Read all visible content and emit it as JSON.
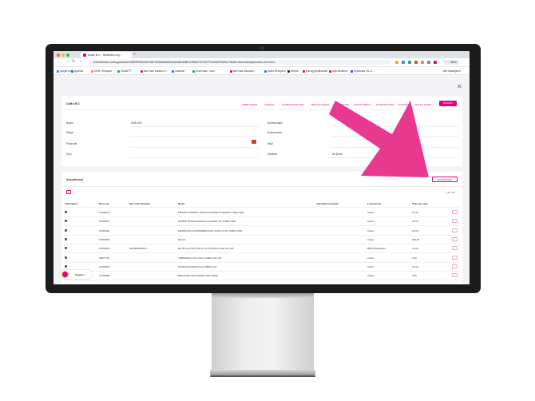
{
  "browser": {
    "tab_title": "DoBo B.V. - Bestellen org... ",
    "new_tab": "+",
    "url": "hub.bartrack.com/organizations/ff5939952d49a7a0b7634f2a85e0b4aaea59c8d8be23f9a97b7016770c26b2076d0c27detail=assortment&previous-url=/users",
    "profile": "Werk",
    "bookmarks": [
      {
        "label": "google mail",
        "color": "#4285f4"
      },
      {
        "label": "Agenda",
        "color": "#1a73e8"
      },
      {
        "label": "CRM | Hubspot",
        "color": "#ff7a59"
      },
      {
        "label": "ChatGPT",
        "color": "#10a37f"
      },
      {
        "label": "BarTrack Kanban b...",
        "color": "#e5007d"
      },
      {
        "label": "Leadinfo",
        "color": "#2f6fd6"
      },
      {
        "label": "Excel taak - snel...",
        "color": "#21a366"
      },
      {
        "label": "BarTrack Inkoopm...",
        "color": "#e5007d"
      },
      {
        "label": "Sales Recepten",
        "color": "#1a73e8"
      },
      {
        "label": "GitHub",
        "color": "#24292e"
      },
      {
        "label": "pricing groothandel",
        "color": "#e5007d"
      },
      {
        "label": "prijs bestellen",
        "color": "#e5007d"
      },
      {
        "label": "Synthesia | AI vi...",
        "color": "#4b3cfa"
      }
    ],
    "all_bookmarks": "Alle bladwijzers"
  },
  "company": {
    "name": "DoBo B.V.",
    "tabs": [
      "GEBRUIKERS",
      "AGENDA",
      "LEVERINGSOPTIES",
      "BESTELLINGEN",
      "ACTIVITEITEN",
      "ASSORTIMENT",
      "LEVERANCIERS",
      "LOCATIES",
      "INSTELLINGEN"
    ],
    "edit_label": "BEWERK",
    "fields_left": [
      {
        "label": "Naam",
        "value": "DoBo B.V."
      },
      {
        "label": "Straat",
        "value": ""
      },
      {
        "label": "Postcode",
        "value": ""
      },
      {
        "label": "GLN",
        "value": ""
      }
    ],
    "fields_right": [
      {
        "label": "Domeinnaam",
        "value": ""
      },
      {
        "label": "Huisnummer",
        "value": ""
      },
      {
        "label": "Stad",
        "value": ""
      },
      {
        "label": "Klantkee",
        "value": "De Bever"
      }
    ]
  },
  "assortment": {
    "title": "Assortiment",
    "import_label": "IMPORTEREN",
    "filter_icon_glyph": "≡",
    "pager": "1-10 / 55",
    "columns": [
      "Afbeelding",
      "Barcode",
      "Barcode fabrikant",
      "Naam",
      "Bestelhoeveelheid",
      "Leverancier",
      "Prijs per stuk"
    ],
    "rows": [
      {
        "barcode": "16038143",
        "barcode_fab": "",
        "name": "MINIMS POVIDON JODIUM OOGDR 5I MINIMS TUBE 0,5ML",
        "qty": "",
        "supplier": "Cebon",
        "price": "12,40"
      },
      {
        "barcode": "15308214",
        "barcode_fab": "",
        "name": "MINIMS TETRACAINE HCL OOGDR 1% TUBE 0,5ML",
        "qty": "",
        "supplier": "Cebon",
        "price": "13,00"
      },
      {
        "barcode": "15303492",
        "barcode_fab": "",
        "name": "MINIMS PILOCARPINENITRAAT OOGD R 2% TUBE 0,5ML",
        "qty": "",
        "supplier": "Cebon",
        "price": "13,00"
      },
      {
        "barcode": "15503656",
        "barcode_fab": "",
        "name": "Mecrat",
        "qty": "",
        "supplier": "Cebon",
        "price": "204,00"
      },
      {
        "barcode": "12531863",
        "barcode_fab": "4013285138514",
        "name": "BH 56 inch DIN 3126 E 6,3 T15x25mm Rak van 100",
        "qty": "",
        "supplier": "BRKS Nederland",
        "price": "13,00"
      },
      {
        "barcode": "15827767",
        "barcode_fab": "",
        "name": "TOBRADEX OOG ZALF TUBE 3,5G 107",
        "qty": "",
        "supplier": "Cebon",
        "price": "4,20"
      },
      {
        "barcode": "14795433",
        "barcode_fab": "",
        "name": "DIAMOX WUPER FLAC 500MG 107",
        "qty": "",
        "supplier": "Cebon",
        "price": "15,00"
      },
      {
        "barcode": "12105689",
        "barcode_fab": "",
        "name": "BETADINE OPLOSSING 10% 120ML",
        "qty": "",
        "supplier": "Cebon",
        "price": "5,99"
      }
    ]
  },
  "support": {
    "label": "Support"
  },
  "colors": {
    "accent": "#e5007d",
    "arrow": "#e8388f"
  }
}
